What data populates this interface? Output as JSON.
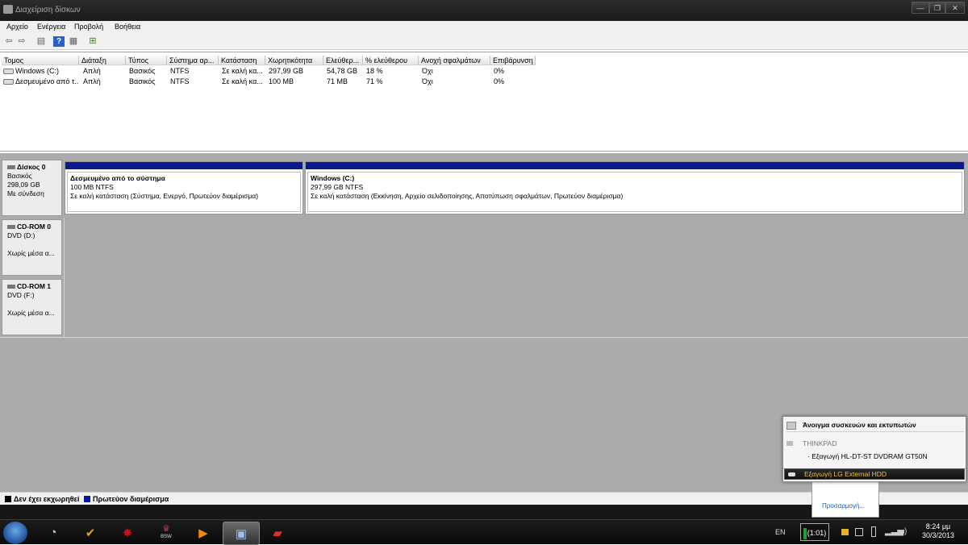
{
  "window": {
    "title": "Διαχείριση δίσκων",
    "min_glyph": "—",
    "max_glyph": "❐",
    "close_glyph": "✕"
  },
  "menu": [
    "Αρχείο",
    "Ενέργεια",
    "Προβολή",
    "Βοήθεια"
  ],
  "toolbar": {
    "icons": [
      "back-arrow-icon",
      "forward-arrow-icon",
      "properties-icon",
      "help-icon",
      "drive-view-icon",
      "refresh-icon"
    ],
    "back_glyph": "⇦",
    "forward_glyph": "⇨",
    "props_glyph": "▤",
    "help_glyph": "?",
    "view_glyph": "▦",
    "refresh_glyph": "⊞"
  },
  "volume_table": {
    "columns": [
      "Τομος",
      "Διάταξη",
      "Τύπος",
      "Σύστημα αρ...",
      "Κατάσταση",
      "Χωρητικότητα",
      "Ελεύθερ...",
      "% ελεύθερου",
      "Ανοχή σφαλμάτων",
      "Επιβάρυνση"
    ],
    "rows": [
      {
        "name": "Windows (C:)",
        "layout": "Απλή",
        "type": "Βασικός",
        "fs": "NTFS",
        "status": "Σε καλή κα...",
        "capacity": "297,99 GB",
        "free": "54,78 GB",
        "pct": "18 %",
        "fault": "Όχι",
        "overhead": "0%"
      },
      {
        "name": "Δεσμευμένο από τ...",
        "layout": "Απλή",
        "type": "Βασικός",
        "fs": "NTFS",
        "status": "Σε καλή κα...",
        "capacity": "100 MB",
        "free": "71 MB",
        "pct": "71 %",
        "fault": "Όχι",
        "overhead": "0%"
      }
    ]
  },
  "disks": [
    {
      "name": "Δίσκος 0",
      "line1": "Βασικός",
      "line2": "298,09 GB",
      "line3": "Με σύνδεση"
    },
    {
      "name": "CD-ROM 0",
      "line1": "DVD (D:)",
      "line2": "",
      "line3": "Χωρίς μέσα α..."
    },
    {
      "name": "CD-ROM 1",
      "line1": "DVD (F:)",
      "line2": "",
      "line3": "Χωρίς μέσα α..."
    }
  ],
  "partitions": [
    {
      "title": "Δεσμευμένο από το σύστημα",
      "size": "100 MB NTFS",
      "status": "Σε καλή κατάσταση (Σύστημα, Ενεργό, Πρωτεύον διαμέρισμα)"
    },
    {
      "title": "Windows  (C:)",
      "size": "297,99 GB NTFS",
      "status": "Σε καλή κατάσταση (Εκκίνηση, Αρχείο σελιδοποίησης, Αποτύπωση σφαλμάτων, Πρωτεύον διαμέρισμα)"
    }
  ],
  "legend": [
    {
      "label": "Δεν έχει εκχωρηθεί",
      "color": "#000000"
    },
    {
      "label": "Πρωτεύον διαμέρισμα",
      "color": "#0a1a8e"
    }
  ],
  "popup": {
    "header": "Άνοιγμα συσκευών και εκτυπωτών",
    "group": "THINKPAD",
    "eject_dvd": "Εξαγωγή HL-DT-ST DVDRAM GT50N",
    "eject_hdd": "Εξαγωγή LG External HDD",
    "customize": "Προσαρμογή..."
  },
  "taskbar": {
    "apps": [
      "explorer-icon",
      "winamp-icon",
      "splash-icon",
      "bsw-icon",
      "media-player-icon",
      "computer-management-icon",
      "toolbox-icon"
    ],
    "bsw_label": "BSW",
    "lang": "EN",
    "battery_time": "(1:01)",
    "time": "8:24 μμ",
    "date": "30/3/2013"
  }
}
